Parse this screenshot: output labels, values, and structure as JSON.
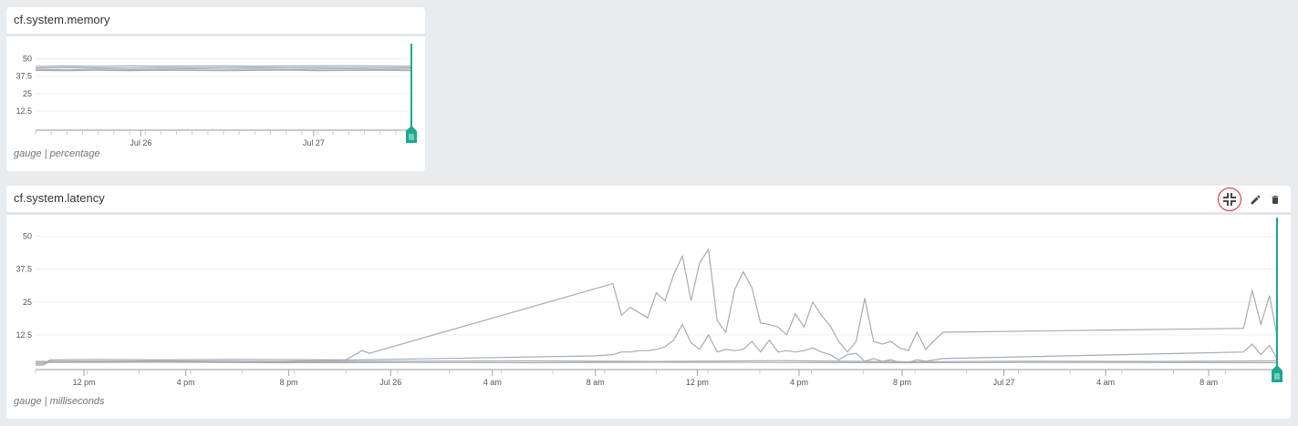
{
  "panels": [
    {
      "title": "cf.system.memory",
      "footer_type": "gauge",
      "footer_unit": "percentage",
      "chart_data": {
        "type": "line",
        "title": "cf.system.memory",
        "xlabel": "",
        "ylabel": "",
        "y_ticks": [
          "50",
          "37.5",
          "25",
          "12.5"
        ],
        "y_tick_values": [
          50,
          37.5,
          25,
          12.5
        ],
        "ylim": [
          0,
          53
        ],
        "x_tick_labels": [
          "Jul 26",
          "Jul 27"
        ],
        "x_tick_positions": [
          0.28,
          0.74
        ],
        "grid": true,
        "series": [
          {
            "values": [
              44.5,
              44.8,
              44.6,
              44.9,
              44.7,
              44.8,
              44.9,
              44.6,
              44.8,
              44.9,
              45.0,
              44.8,
              44.7
            ]
          },
          {
            "values": [
              43.4,
              43.6,
              43.5,
              43.4,
              43.7,
              43.5,
              43.6,
              43.8,
              43.5,
              43.6,
              43.7,
              43.5,
              43.6
            ]
          },
          {
            "values": [
              42.4,
              42.1,
              42.6,
              42.3,
              42.5,
              42.7,
              42.4,
              42.6,
              42.3,
              42.5,
              42.8,
              42.4,
              42.5
            ]
          },
          {
            "values": [
              41.6,
              41.4,
              41.7,
              41.5,
              41.8,
              41.6,
              41.4,
              41.7,
              41.9,
              41.5,
              41.6,
              41.8,
              41.5
            ]
          }
        ]
      }
    },
    {
      "title": "cf.system.latency",
      "footer_type": "gauge",
      "footer_unit": "milliseconds",
      "icons": {
        "minimize": "minimize-icon",
        "edit": "pencil-icon",
        "delete": "trash-icon"
      },
      "accent_color": "#1aaa8e",
      "chart_data": {
        "type": "line",
        "title": "cf.system.latency",
        "xlabel": "",
        "ylabel": "",
        "y_ticks": [
          "50",
          "37.5",
          "25",
          "12.5"
        ],
        "y_tick_values": [
          50,
          37.5,
          25,
          12.5
        ],
        "ylim": [
          0,
          53
        ],
        "x_tick_labels": [
          "12 pm",
          "4 pm",
          "8 pm",
          "Jul 26",
          "4 am",
          "8 am",
          "12 pm",
          "4 pm",
          "8 pm",
          "Jul 27",
          "4 am",
          "8 am"
        ],
        "x_tick_positions": [
          0.039,
          0.121,
          0.204,
          0.286,
          0.368,
          0.451,
          0.533,
          0.615,
          0.698,
          0.78,
          0.862,
          0.945
        ],
        "grid": true,
        "series": [
          {
            "x": [
              0,
              0.006,
              0.012,
              0.05,
              0.1,
              0.17,
              0.25,
              0.263,
              0.269,
              0.465,
              0.472,
              0.479,
              0.486,
              0.493,
              0.5,
              0.507,
              0.514,
              0.521,
              0.528,
              0.535,
              0.542,
              0.549,
              0.556,
              0.563,
              0.57,
              0.577,
              0.584,
              0.591,
              0.598,
              0.605,
              0.612,
              0.619,
              0.626,
              0.633,
              0.64,
              0.647,
              0.654,
              0.661,
              0.668,
              0.675,
              0.682,
              0.689,
              0.696,
              0.703,
              0.71,
              0.717,
              0.724,
              0.731,
              0.973,
              0.98,
              0.987,
              0.994,
              1.0
            ],
            "values": [
              1.5,
              1.5,
              3.0,
              3.2,
              3.0,
              3.2,
              3.0,
              6.5,
              5.5,
              32,
              20,
              23,
              21,
              19,
              28.5,
              25.5,
              35.5,
              42.5,
              25.5,
              40,
              45,
              18,
              13.5,
              29.5,
              36.5,
              30.5,
              17,
              16.5,
              15.5,
              12.5,
              20.5,
              15.5,
              25,
              20,
              16,
              10,
              6,
              10,
              26.5,
              10,
              9,
              10,
              7.5,
              6.5,
              13.5,
              7,
              10.5,
              13.5,
              15,
              29.5,
              16.5,
              27.5,
              12
            ]
          },
          {
            "x": [
              0,
              0.006,
              0.012,
              0.2,
              0.45,
              0.465,
              0.472,
              0.479,
              0.486,
              0.493,
              0.5,
              0.507,
              0.514,
              0.521,
              0.528,
              0.535,
              0.542,
              0.549,
              0.556,
              0.563,
              0.57,
              0.577,
              0.584,
              0.591,
              0.598,
              0.605,
              0.612,
              0.619,
              0.626,
              0.633,
              0.64,
              0.647,
              0.654,
              0.661,
              0.668,
              0.675,
              0.682,
              0.689,
              0.696,
              0.703,
              0.71,
              0.717,
              0.724,
              0.731,
              0.973,
              0.98,
              0.987,
              0.994,
              1.0
            ],
            "values": [
              1.0,
              1.0,
              2.5,
              2.5,
              4.5,
              5.0,
              6.0,
              6.0,
              6.5,
              6.5,
              7.0,
              8.0,
              10.5,
              16.5,
              9.5,
              7.0,
              12.5,
              6.0,
              7.0,
              6.5,
              7.0,
              10,
              6.0,
              10.5,
              6.0,
              6.5,
              6.0,
              6.5,
              7.5,
              6.0,
              5.0,
              3.0,
              5.0,
              5.5,
              2.5,
              3.5,
              2.5,
              3.0,
              2.0,
              2.0,
              3.0,
              2.5,
              3.0,
              3.5,
              6.0,
              9.0,
              5.0,
              8.5,
              3.5
            ]
          },
          {
            "x": [
              0,
              0.1,
              0.2,
              0.3,
              0.4,
              0.5,
              0.6,
              0.7,
              0.8,
              0.9,
              1.0
            ],
            "values": [
              2.4,
              2.6,
              2.3,
              2.5,
              2.6,
              2.4,
              2.7,
              2.3,
              2.5,
              2.4,
              2.6
            ]
          },
          {
            "x": [
              0,
              0.1,
              0.2,
              0.3,
              0.4,
              0.5,
              0.6,
              0.7,
              0.8,
              0.9,
              1.0
            ],
            "values": [
              2.0,
              2.1,
              1.9,
              2.0,
              1.9,
              2.1,
              2.0,
              1.9,
              2.0,
              2.0,
              1.9
            ]
          }
        ]
      }
    }
  ]
}
